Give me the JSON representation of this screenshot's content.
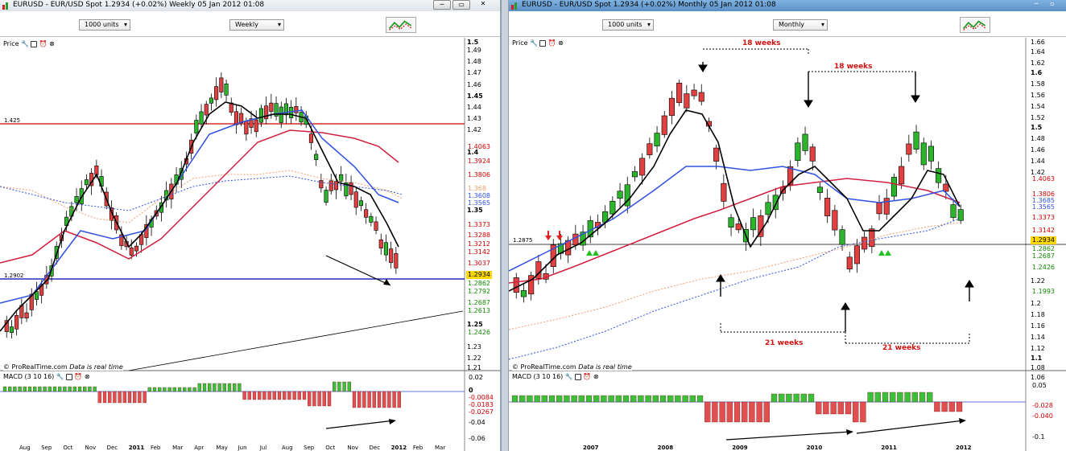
{
  "left": {
    "title": "EURUSD - EUR/USD Spot   1.2934 (+0.02%)   Weekly  05 Jan 2012 01:08",
    "units": "1000 units",
    "period": "Weekly",
    "price_label": "Price",
    "macd_label": "MACD (3 10 16)",
    "credit_site": "© ProRealTime.com",
    "credit_note": "Data is real time",
    "yaxis": [
      "1.5",
      "1.49",
      "1.48",
      "1.47",
      "1.46",
      "1.45",
      "1.44",
      "1.43",
      "1.42",
      "1.4",
      "1.35",
      "1.25",
      "1.23",
      "1.22",
      "1.21"
    ],
    "tags": {
      "t1": "1.4063",
      "t2": "1.3924",
      "t3": "1.3806",
      "t4": "1.3565",
      "t5": "1.3373",
      "t6": "1.3288",
      "t7": "1.3212",
      "t8": "1.3142",
      "t9": "1.3037",
      "t10": "1.2934",
      "t11": "1.2862",
      "t12": "1.2792",
      "t13": "1.2687",
      "t14": "1.2613",
      "t15": "1.2426",
      "t16": "1.368",
      "t17": "1.3608"
    },
    "hline_red": "1.425",
    "hline_blue": "1.2902",
    "macd_axis": [
      "0.02",
      "0",
      "-0.0084",
      "-0.0183",
      "-0.0267",
      "-0.04",
      "-0.06"
    ],
    "xaxis": [
      "Aug",
      "Sep",
      "Oct",
      "Nov",
      "Dec",
      "2011",
      "Feb",
      "Mar",
      "Apr",
      "May",
      "Jun",
      "Jul",
      "Aug",
      "Sep",
      "Oct",
      "Nov",
      "Dec",
      "2012",
      "Feb",
      "Mar"
    ]
  },
  "right": {
    "title": "EURUSD - EUR/USD Spot   1.2934 (+0.02%)   Monthly  05 Jan 2012 01:08",
    "units": "1000 units",
    "period": "Monthly",
    "price_label": "Price",
    "macd_label": "MACD (3 10 16)",
    "credit_site": "© ProRealTime.com",
    "credit_note": "Data is real time",
    "yaxis": [
      "1.66",
      "1.64",
      "1.62",
      "1.6",
      "1.58",
      "1.56",
      "1.54",
      "1.52",
      "1.5",
      "1.48",
      "1.46",
      "1.44",
      "1.42",
      "1.22",
      "1.2",
      "1.18",
      "1.16",
      "1.14",
      "1.12",
      "1.1",
      "1.08",
      "1.06"
    ],
    "tags": {
      "t1": "1.4063",
      "t2": "1.3806",
      "t3": "1.3685",
      "t4": "1.3565",
      "t5": "1.3373",
      "t6": "1.3142",
      "t7": "1.2934",
      "t8": "1.2426",
      "t9": "1.1993",
      "t10": "1.2862",
      "t11": "1.2687"
    },
    "hline": "1.2875",
    "ann": {
      "a1": "18 weeks",
      "a2": "18 weeks",
      "a3": "21 weeks",
      "a4": "21 weeks"
    },
    "macd_axis": [
      "0.05",
      "0",
      "-0.1"
    ],
    "macd_tags": [
      "-0.028",
      "-0.040"
    ],
    "xaxis": [
      "2007",
      "2008",
      "2009",
      "2010",
      "2011",
      "2012"
    ]
  },
  "colors": {
    "up": "#2bb52b",
    "down": "#e04040",
    "ma_black": "#000000",
    "ma_blue": "#3050e0",
    "ma_red": "#d02040",
    "ma_orange": "#f0a070",
    "hline_red": "#cc0000",
    "hline_blue": "#0000aa"
  }
}
